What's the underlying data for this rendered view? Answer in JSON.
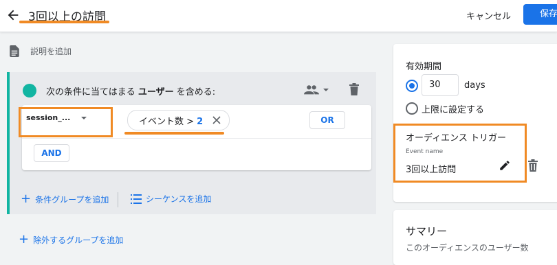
{
  "header": {
    "title": "3回以上の訪問",
    "cancel_label": "キャンセル",
    "save_label": "保存"
  },
  "description": {
    "label": "説明を追加"
  },
  "condition_group": {
    "text_prefix": "次の条件に当てはまる",
    "text_bold": "ユーザー",
    "text_suffix": "を含める:",
    "scope_dropdown": "session_...",
    "chip_label": "イベント数 >",
    "chip_value": "2",
    "or_label": "OR",
    "and_label": "AND"
  },
  "actions": {
    "add_condition_group": "条件グループを追加",
    "add_sequence": "シーケンスを追加",
    "add_exclude_group": "除外するグループを追加"
  },
  "membership": {
    "label": "有効期間",
    "days_value": "30",
    "days_unit": "days",
    "max_label": "上限に設定する",
    "selected": "days"
  },
  "trigger": {
    "title": "オーディエンス トリガー",
    "event_name_label": "Event name",
    "event_name_value": "3回以上訪問"
  },
  "summary": {
    "title": "サマリー",
    "partial_text": "このオーディエンスのユーザー数"
  },
  "colors": {
    "accent_blue": "#1a73e8",
    "teal": "#12b5a2",
    "highlight_orange": "#f08a24"
  }
}
